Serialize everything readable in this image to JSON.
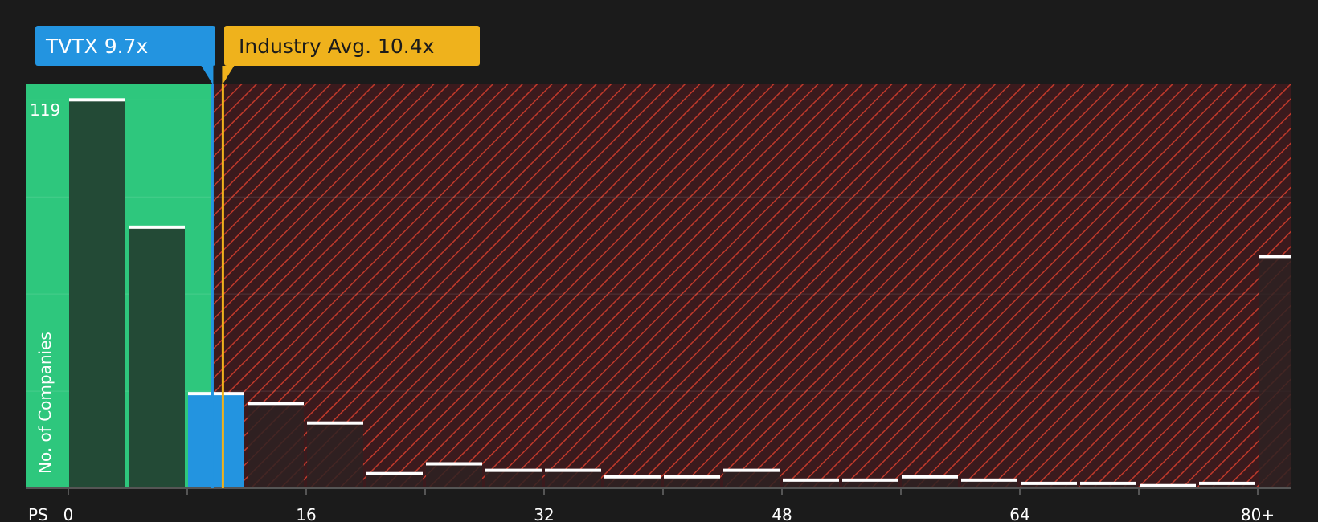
{
  "colors": {
    "background": "#1b1b1b",
    "fair_zone": "#2ec77d",
    "over_zone": "#3b1a1d",
    "over_hatch": "#c0392b",
    "bar_fair": "#234a36",
    "bar_company": "#2394e0",
    "bar_over": "#2e2222",
    "bar_cap": "#ffffff",
    "company_callout": "#2394e0",
    "industry_callout": "#efb21c",
    "industry_line": "#efb21c",
    "axis": "#555555",
    "gridline": "#ffffff"
  },
  "callouts": {
    "company": "TVTX 9.7x",
    "industry": "Industry Avg. 10.4x"
  },
  "chart_data": {
    "type": "bar",
    "xlabel": "PS",
    "ylabel": "No. of Companies",
    "x_ticks": [
      "0",
      "16",
      "32",
      "48",
      "64",
      "80+"
    ],
    "y_tick_labels": [
      "119"
    ],
    "ylim": [
      0,
      124
    ],
    "bin_width": 4,
    "company_value": 9.7,
    "industry_avg": 10.4,
    "bars": [
      {
        "x": 0,
        "value": 119,
        "zone": "fair"
      },
      {
        "x": 4,
        "value": 80,
        "zone": "fair"
      },
      {
        "x": 8,
        "value": 29,
        "zone": "company"
      },
      {
        "x": 12,
        "value": 26,
        "zone": "over"
      },
      {
        "x": 16,
        "value": 20,
        "zone": "over"
      },
      {
        "x": 20,
        "value": 4.5,
        "zone": "over"
      },
      {
        "x": 24,
        "value": 7.5,
        "zone": "over"
      },
      {
        "x": 28,
        "value": 5.5,
        "zone": "over"
      },
      {
        "x": 32,
        "value": 5.5,
        "zone": "over"
      },
      {
        "x": 36,
        "value": 3.5,
        "zone": "over"
      },
      {
        "x": 40,
        "value": 3.5,
        "zone": "over"
      },
      {
        "x": 44,
        "value": 5.5,
        "zone": "over"
      },
      {
        "x": 48,
        "value": 2.5,
        "zone": "over"
      },
      {
        "x": 52,
        "value": 2.5,
        "zone": "over"
      },
      {
        "x": 56,
        "value": 3.5,
        "zone": "over"
      },
      {
        "x": 60,
        "value": 2.5,
        "zone": "over"
      },
      {
        "x": 64,
        "value": 1.5,
        "zone": "over"
      },
      {
        "x": 68,
        "value": 1.5,
        "zone": "over"
      },
      {
        "x": 72,
        "value": 0.8,
        "zone": "over"
      },
      {
        "x": 76,
        "value": 1.5,
        "zone": "over"
      },
      {
        "x": 80,
        "value": 71,
        "zone": "over"
      }
    ]
  }
}
